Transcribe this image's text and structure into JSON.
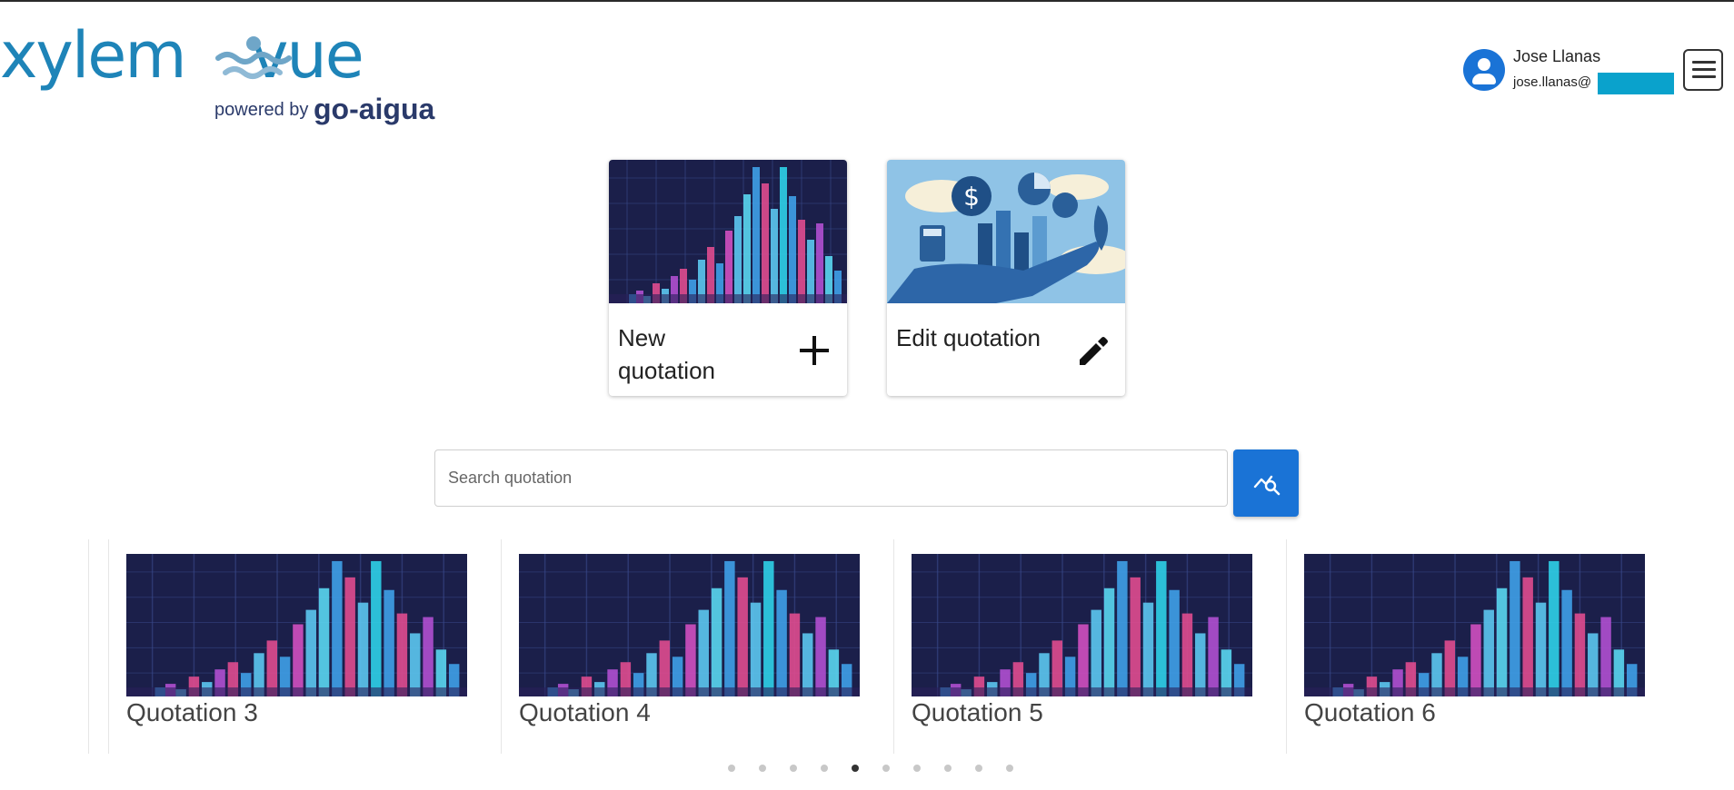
{
  "brand": {
    "name_left": "xylem",
    "name_right": "vue",
    "powered_by": "powered by",
    "partner": "go-aigua"
  },
  "user": {
    "name": "Jose Llanas",
    "email": "jose.llanas@"
  },
  "actions": [
    {
      "label": "New quotation",
      "icon": "plus-icon"
    },
    {
      "label": "Edit quotation",
      "icon": "pencil-icon"
    }
  ],
  "search": {
    "placeholder": "Search quotation",
    "value": "",
    "button_icon": "chart-search-icon"
  },
  "quotations": [
    {
      "title": "Quotation 3"
    },
    {
      "title": "Quotation 4"
    },
    {
      "title": "Quotation 5"
    },
    {
      "title": "Quotation 6"
    }
  ],
  "pagination": {
    "total": 10,
    "active_index": 4
  },
  "colors": {
    "brand": "#1e84b8",
    "accent": "#1a73d6",
    "redaction": "#0aa2cc"
  }
}
